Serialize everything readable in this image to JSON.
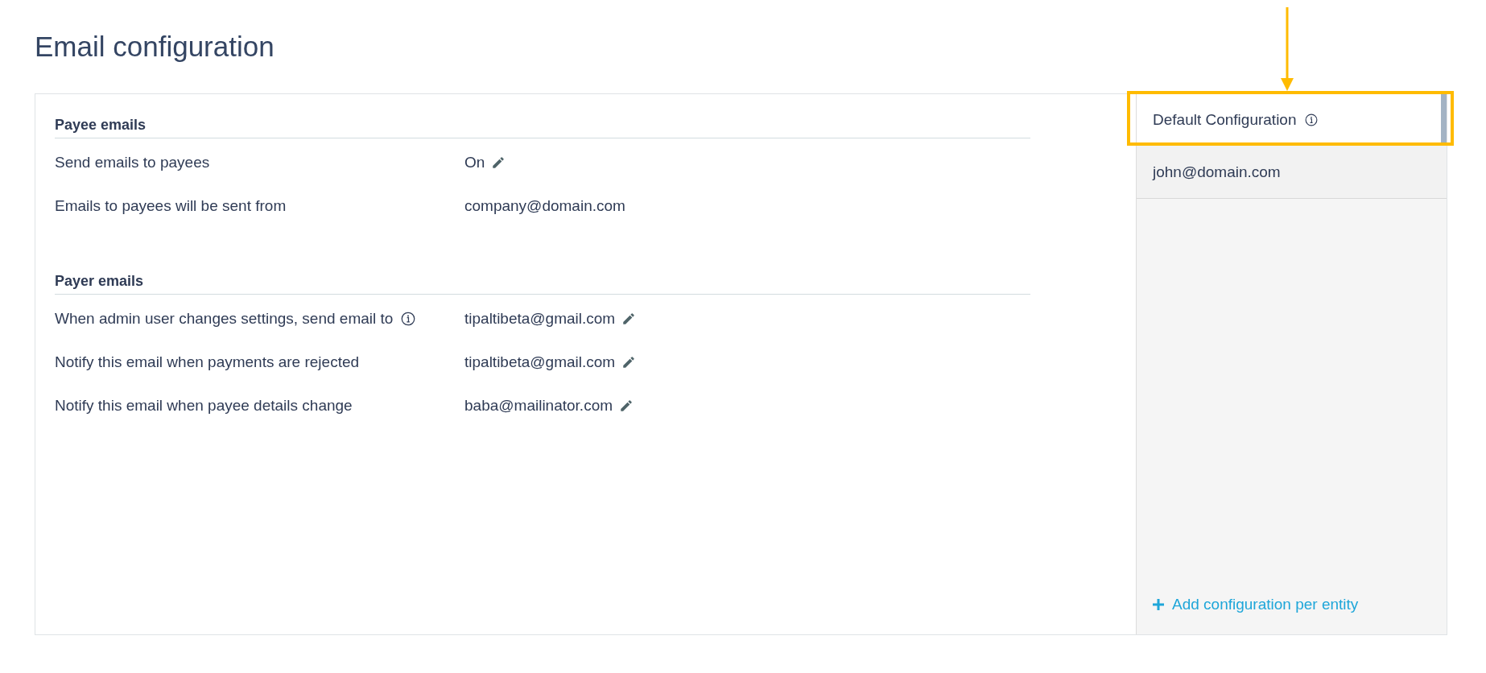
{
  "page": {
    "title": "Email configuration"
  },
  "sections": [
    {
      "title": "Payee emails",
      "rows": [
        {
          "label": "Send emails to payees",
          "info": false,
          "value": "On",
          "editable": true
        },
        {
          "label": "Emails to payees will be sent from",
          "info": false,
          "value": "company@domain.com",
          "editable": false
        }
      ]
    },
    {
      "title": "Payer emails",
      "rows": [
        {
          "label": "When admin user changes settings, send email to",
          "info": true,
          "value": "tipaltibeta@gmail.com",
          "editable": true
        },
        {
          "label": "Notify this email when payments are rejected",
          "info": false,
          "value": "tipaltibeta@gmail.com",
          "editable": true
        },
        {
          "label": "Notify this email when payee details change",
          "info": false,
          "value": "baba@mailinator.com",
          "editable": true
        }
      ]
    }
  ],
  "configurations": [
    {
      "label": "Default Configuration",
      "info": true,
      "selected": true,
      "highlighted": true
    },
    {
      "label": "john@domain.com",
      "info": false,
      "selected": false,
      "highlighted": false
    }
  ],
  "add_link": {
    "label": "Add configuration per entity"
  }
}
